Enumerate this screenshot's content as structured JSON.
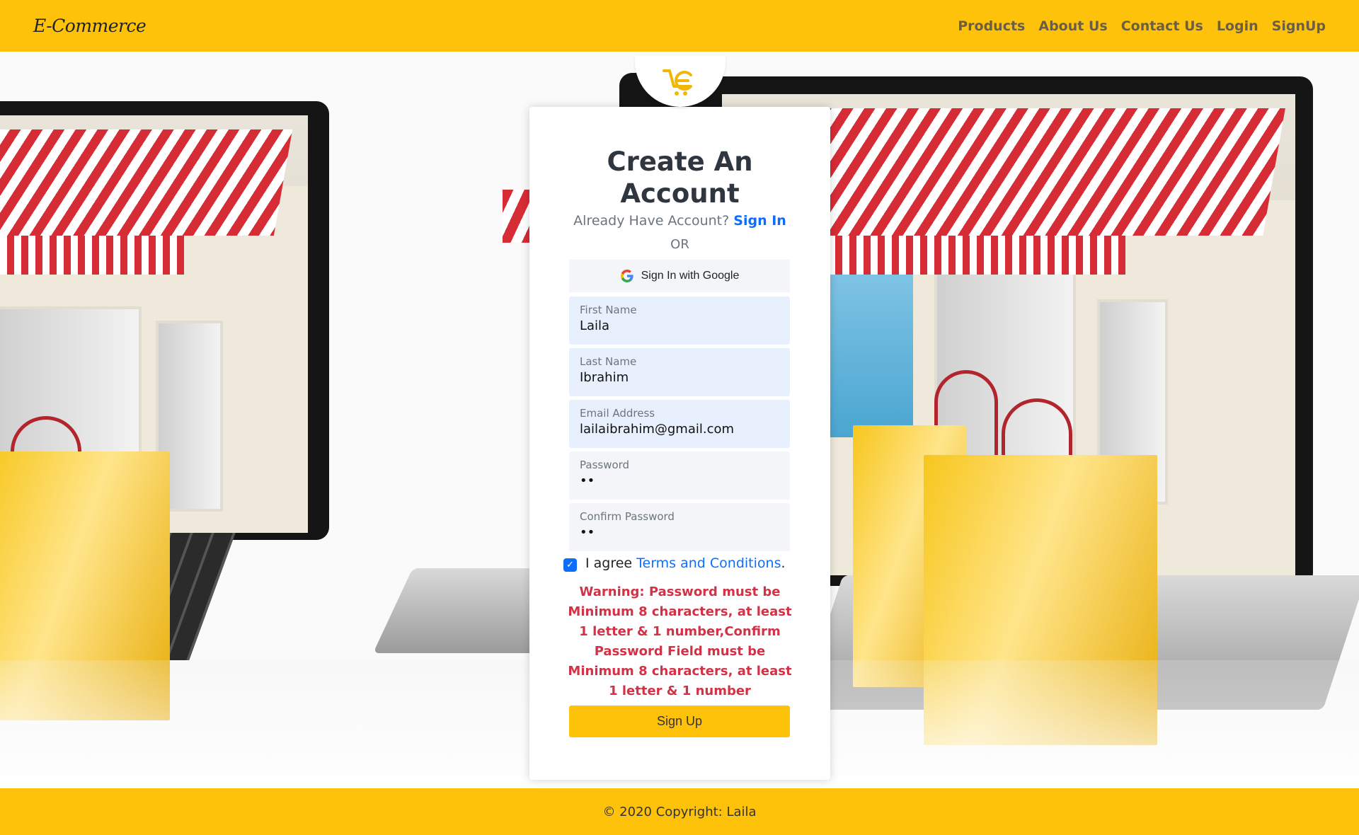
{
  "navbar": {
    "brand": "E-Commerce",
    "links": [
      "Products",
      "About Us",
      "Contact Us",
      "Login",
      "SignUp"
    ]
  },
  "form": {
    "title_line1": "Create An",
    "title_line2": "Account",
    "already_text": "Already Have Account?",
    "signin_link": "Sign In",
    "or_text": "OR",
    "google_button": "Sign In with Google",
    "fields": [
      {
        "label": "First Name",
        "value": "Laila"
      },
      {
        "label": "Last Name",
        "value": "Ibrahim"
      },
      {
        "label": "Email Address",
        "value": "lailaibrahim@gmail.com"
      },
      {
        "label": "Password",
        "value": "••"
      },
      {
        "label": "Confirm Password",
        "value": "••"
      }
    ],
    "agree_text": "I agree",
    "terms_link": "Terms and Conditions",
    "terms_period": ".",
    "warning": "Warning: Password must be Minimum 8 characters, at least 1 letter & 1 number,Confirm Password Field must be Minimum 8 characters, at least 1 letter & 1 number",
    "submit_label": "Sign Up",
    "agree_checked": true
  },
  "footer": {
    "copyright": "© 2020 Copyright: Laila"
  },
  "colors": {
    "brand_yellow": "#fec20b",
    "link_blue": "#0d6efd",
    "warning_red": "#d33146",
    "autofill_blue": "#e8f0fe"
  },
  "icons": [
    "cart-logo-icon",
    "google-icon",
    "checkmark-icon"
  ]
}
